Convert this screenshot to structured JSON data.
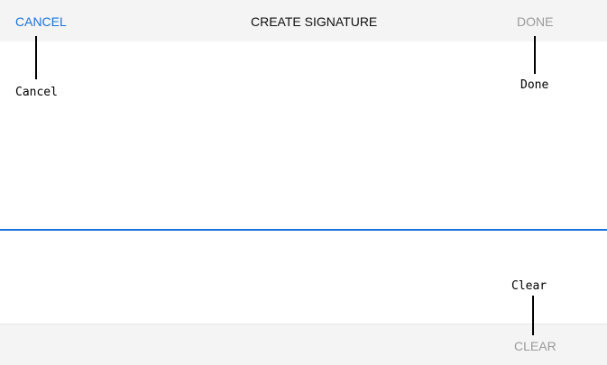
{
  "header": {
    "cancel_label": "CANCEL",
    "title": "CREATE SIGNATURE",
    "done_label": "DONE"
  },
  "footer": {
    "clear_label": "CLEAR"
  },
  "callouts": {
    "cancel": "Cancel",
    "done": "Done",
    "clear": "Clear"
  },
  "colors": {
    "accent": "#1a73d9",
    "disabled_text": "#9b9b9b",
    "bar_background": "#f4f4f4"
  }
}
